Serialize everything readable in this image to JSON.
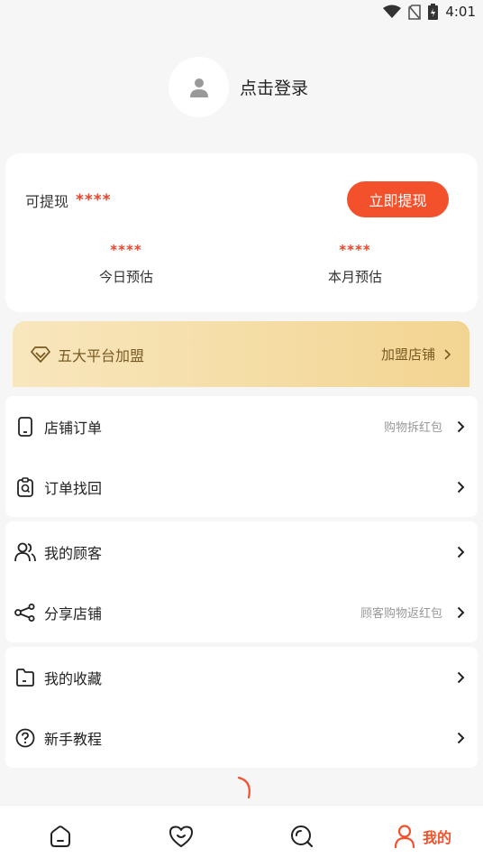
{
  "status_bar": {
    "time": "4:01",
    "icons": [
      "wifi-icon",
      "no-sim-icon",
      "battery-icon"
    ]
  },
  "login": {
    "label": "点击登录",
    "icon": "user-icon"
  },
  "wallet": {
    "withdrawable_label": "可提现",
    "withdrawable_value": "****",
    "withdraw_button": "立即提现",
    "today": {
      "value": "****",
      "label": "今日预估"
    },
    "month": {
      "value": "****",
      "label": "本月预估"
    }
  },
  "vip_banner": {
    "title": "五大平台加盟",
    "link": "加盟店铺",
    "icon": "diamond-icon"
  },
  "menu": {
    "store_orders": {
      "label": "店铺订单",
      "hint": "购物拆红包",
      "icon": "phone-icon"
    },
    "order_recovery": {
      "label": "订单找回",
      "icon": "clipboard-search-icon"
    },
    "my_customers": {
      "label": "我的顾客",
      "icon": "users-icon"
    },
    "share_store": {
      "label": "分享店铺",
      "hint": "顾客购物返红包",
      "icon": "share-icon"
    },
    "my_favorites": {
      "label": "我的收藏",
      "icon": "folder-icon"
    },
    "tutorial": {
      "label": "新手教程",
      "icon": "help-icon"
    }
  },
  "tab_bar": {
    "items": [
      {
        "icon": "home-icon",
        "label": ""
      },
      {
        "icon": "heart-icon",
        "label": ""
      },
      {
        "icon": "search-icon",
        "label": ""
      },
      {
        "icon": "user-icon",
        "label": "我的",
        "active": true
      }
    ]
  },
  "colors": {
    "accent": "#f2512c",
    "vip_gold": "#f3d592",
    "vip_text": "#7a5a24"
  }
}
